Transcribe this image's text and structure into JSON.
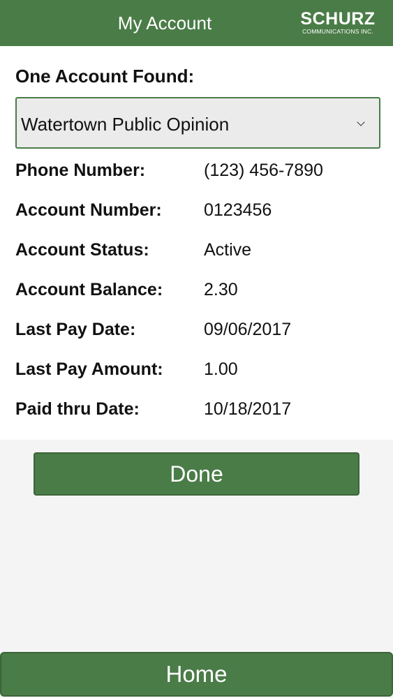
{
  "header": {
    "title": "My Account",
    "logo_main": "SCHURZ",
    "logo_sub": "COMMUNICATIONS INC."
  },
  "account": {
    "found_label": "One Account Found:",
    "selected_publication": "Watertown Public Opinion",
    "fields": [
      {
        "label": "Phone Number:",
        "value": "(123) 456-7890"
      },
      {
        "label": "Account Number:",
        "value": "0123456"
      },
      {
        "label": "Account Status:",
        "value": "Active"
      },
      {
        "label": "Account Balance:",
        "value": "2.30"
      },
      {
        "label": "Last Pay Date:",
        "value": "09/06/2017"
      },
      {
        "label": "Last Pay Amount:",
        "value": "1.00"
      },
      {
        "label": "Paid thru Date:",
        "value": "10/18/2017"
      }
    ]
  },
  "actions": {
    "done_label": "Done",
    "home_label": "Home"
  },
  "colors": {
    "brand_green": "#4a7c47",
    "background": "#f4f4f4"
  }
}
